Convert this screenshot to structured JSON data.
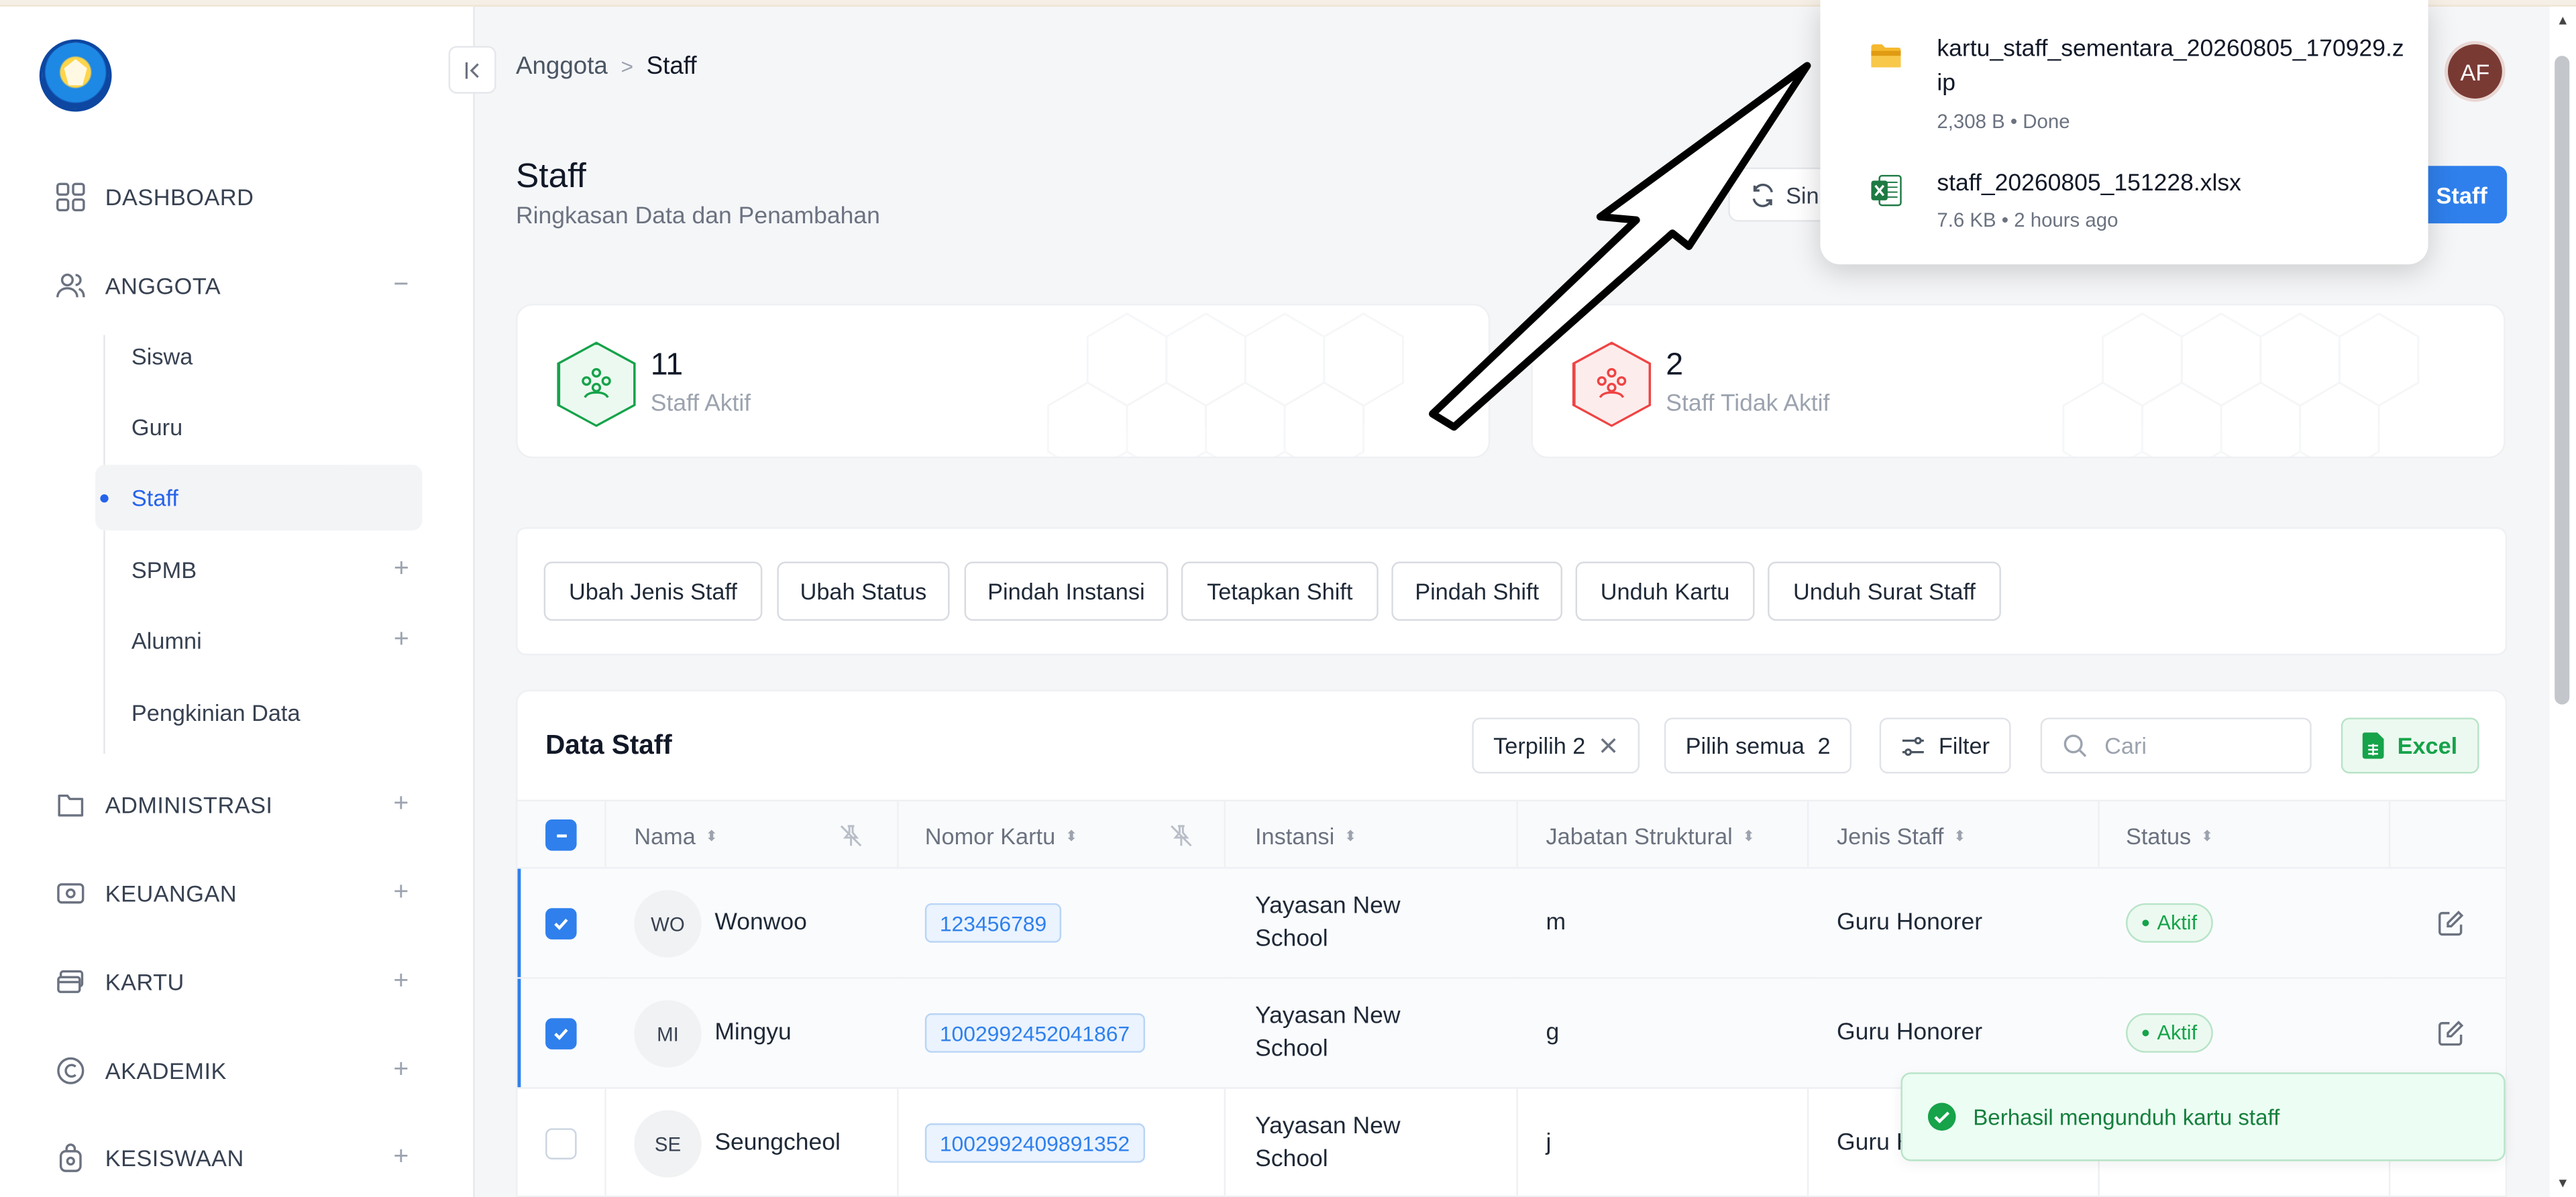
{
  "breadcrumb": {
    "parent": "Anggota",
    "separator": ">",
    "current": "Staff"
  },
  "user": {
    "initials": "AF"
  },
  "sidebar": {
    "dashboard": "DASHBOARD",
    "anggota": "ANGGOTA",
    "anggota_toggle": "−",
    "sub": {
      "siswa": "Siswa",
      "guru": "Guru",
      "staff": "Staff",
      "spmb": "SPMB",
      "alumni": "Alumni",
      "pengkinian": "Pengkinian Data"
    },
    "administrasi": "ADMINISTRASI",
    "keuangan": "KEUANGAN",
    "kartu": "KARTU",
    "akademik": "AKADEMIK",
    "kesiswaan": "KESISWAAN",
    "plus": "+"
  },
  "page": {
    "title": "Staff",
    "subtitle": "Ringkasan Data dan Penambahan",
    "sync_label": "Sin",
    "add_label": "Staff"
  },
  "stats": {
    "active": {
      "count": "11",
      "label": "Staff Aktif",
      "color": "#16a34a"
    },
    "inactive": {
      "count": "2",
      "label": "Staff Tidak Aktif",
      "color": "#ef4444"
    }
  },
  "actions": [
    "Ubah Jenis Staff",
    "Ubah Status",
    "Pindah Instansi",
    "Tetapkan Shift",
    "Pindah Shift",
    "Unduh Kartu",
    "Unduh Surat Staff"
  ],
  "table": {
    "title": "Data Staff",
    "selected_chip": "Terpilih 2",
    "select_all_label": "Pilih semua",
    "select_all_count": "2",
    "filter_label": "Filter",
    "search_placeholder": "Cari",
    "excel_label": "Excel",
    "columns": {
      "name": "Nama",
      "card": "Nomor Kartu",
      "instansi": "Instansi",
      "jabatan": "Jabatan Struktural",
      "jenis": "Jenis Staff",
      "status": "Status"
    },
    "rows": [
      {
        "initials": "WO",
        "name": "Wonwoo",
        "card": "123456789",
        "instansi_1": "Yayasan New",
        "instansi_2": "School",
        "jabatan": "m",
        "jenis": "Guru Honorer",
        "status": "Aktif",
        "selected": true
      },
      {
        "initials": "MI",
        "name": "Mingyu",
        "card": "1002992452041867",
        "instansi_1": "Yayasan New",
        "instansi_2": "School",
        "jabatan": "g",
        "jenis": "Guru Honorer",
        "status": "Aktif",
        "selected": true
      },
      {
        "initials": "SE",
        "name": "Seungcheol",
        "card": "1002992409891352",
        "instansi_1": "Yayasan New",
        "instansi_2": "School",
        "jabatan": "j",
        "jenis": "Guru H",
        "status": "",
        "selected": false
      }
    ]
  },
  "downloads": [
    {
      "name": "kartu_staff_sementara_20260805_170929.zip",
      "meta": "2,308 B • Done",
      "icon": "folder-zip-icon"
    },
    {
      "name": "staff_20260805_151228.xlsx",
      "meta": "7.6 KB • 2 hours ago",
      "icon": "excel-file-icon"
    }
  ],
  "toast": {
    "message": "Berhasil mengunduh kartu staff"
  },
  "colors": {
    "accent": "#2f80ed",
    "success": "#16a34a",
    "danger": "#ef4444"
  }
}
